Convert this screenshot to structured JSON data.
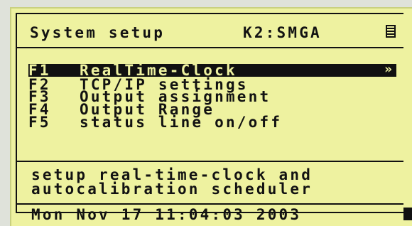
{
  "header": {
    "title": "System setup",
    "device": "K2:SMGA",
    "menu_icon": "menu-icon"
  },
  "menu": {
    "items": [
      {
        "key": "F1",
        "label": "RealTime-Clock",
        "selected": true,
        "arrow": "»"
      },
      {
        "key": "F2",
        "label": "TCP/IP settings"
      },
      {
        "key": "F3",
        "label": "Output assignment"
      },
      {
        "key": "F4",
        "label": "Output Range"
      },
      {
        "key": "F5",
        "label": "status line on/off"
      }
    ]
  },
  "help": {
    "line1": "setup real-time-clock and",
    "line2": "autocalibration scheduler"
  },
  "status": {
    "datetime": "Mon Nov 17 11:04:03 2003"
  }
}
